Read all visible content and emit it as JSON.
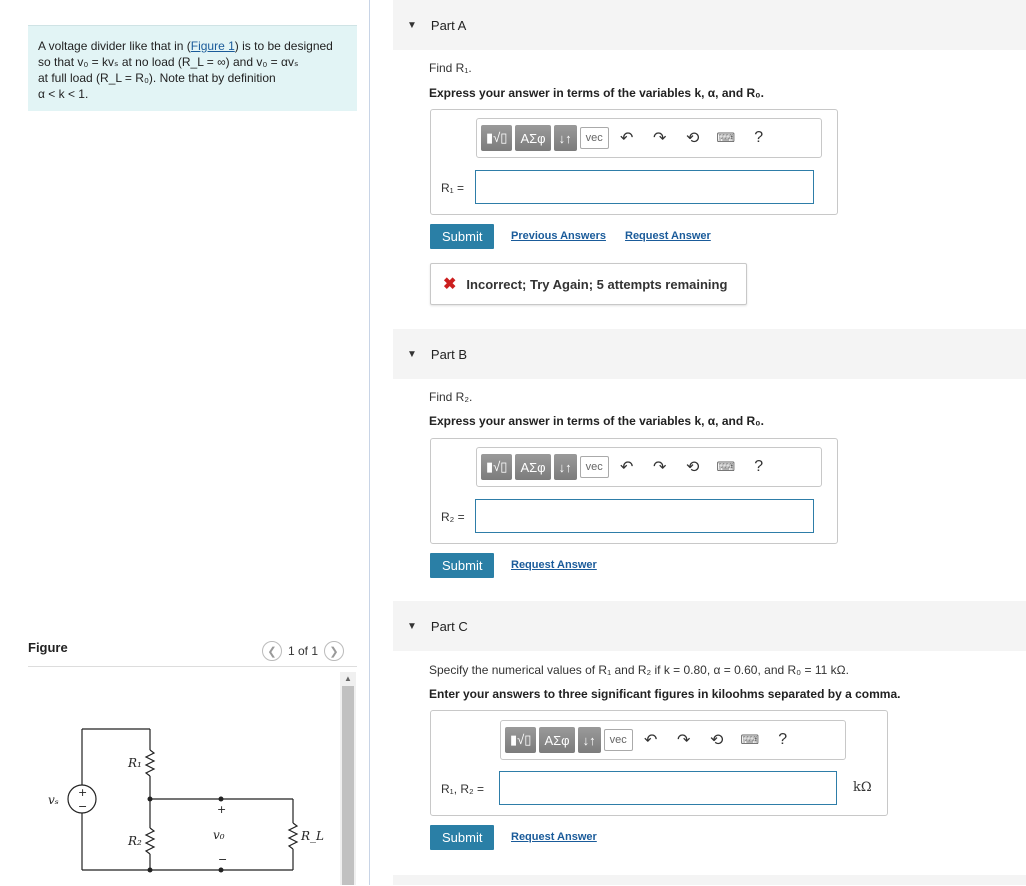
{
  "problem": {
    "line1_a": "A voltage divider like that in (",
    "figure_link": "Figure 1",
    "line1_b": ") is to be designed",
    "line2": "so that v₀ = kvₛ at no load (R_L = ∞) and v₀ = αvₛ",
    "line3": "at full load (R_L = R₀). Note that by definition",
    "line4": "α < k < 1."
  },
  "figure": {
    "title": "Figure",
    "pager_text": "1 of 1",
    "prev_icon": "chevron-left-icon",
    "next_icon": "chevron-right-icon",
    "labels": {
      "vs": "vₛ",
      "r1": "R₁",
      "r2": "R₂",
      "vo": "v₀",
      "rl": "R_L",
      "plus": "+",
      "minus": "−"
    }
  },
  "toolbar": {
    "template_label": "▮√▯",
    "greek_label": "ΑΣφ",
    "arrows_label": "↓↑",
    "vec_label": "vec",
    "undo_icon": "undo-icon",
    "redo_icon": "redo-icon",
    "reset_icon": "reset-icon",
    "keyboard_icon": "keyboard-icon",
    "help_label": "?"
  },
  "parts": {
    "a": {
      "title": "Part A",
      "find": "Find R₁.",
      "express": "Express your answer in terms of the variables k, α, and R₀.",
      "input_label": "R₁ =",
      "input_value": "",
      "submit": "Submit",
      "prev_answers": "Previous Answers",
      "request": "Request Answer",
      "feedback": "Incorrect; Try Again; 5 attempts remaining"
    },
    "b": {
      "title": "Part B",
      "find": "Find R₂.",
      "express": "Express your answer in terms of the variables k, α, and R₀.",
      "input_label": "R₂ =",
      "input_value": "",
      "submit": "Submit",
      "request": "Request Answer"
    },
    "c": {
      "title": "Part C",
      "specify": "Specify the numerical values of R₁ and R₂ if k = 0.80, α = 0.60, and R₀ = 11 kΩ.",
      "express": "Enter your answers to three significant figures in kiloohms separated by a comma.",
      "input_label": "R₁, R₂ =",
      "input_value": "",
      "unit": "kΩ",
      "submit": "Submit",
      "request": "Request Answer"
    }
  },
  "colors": {
    "accent": "#2a7fa6",
    "link": "#1a5b9a",
    "problem_bg": "#e2f4f5",
    "error": "#cc1f1f"
  }
}
